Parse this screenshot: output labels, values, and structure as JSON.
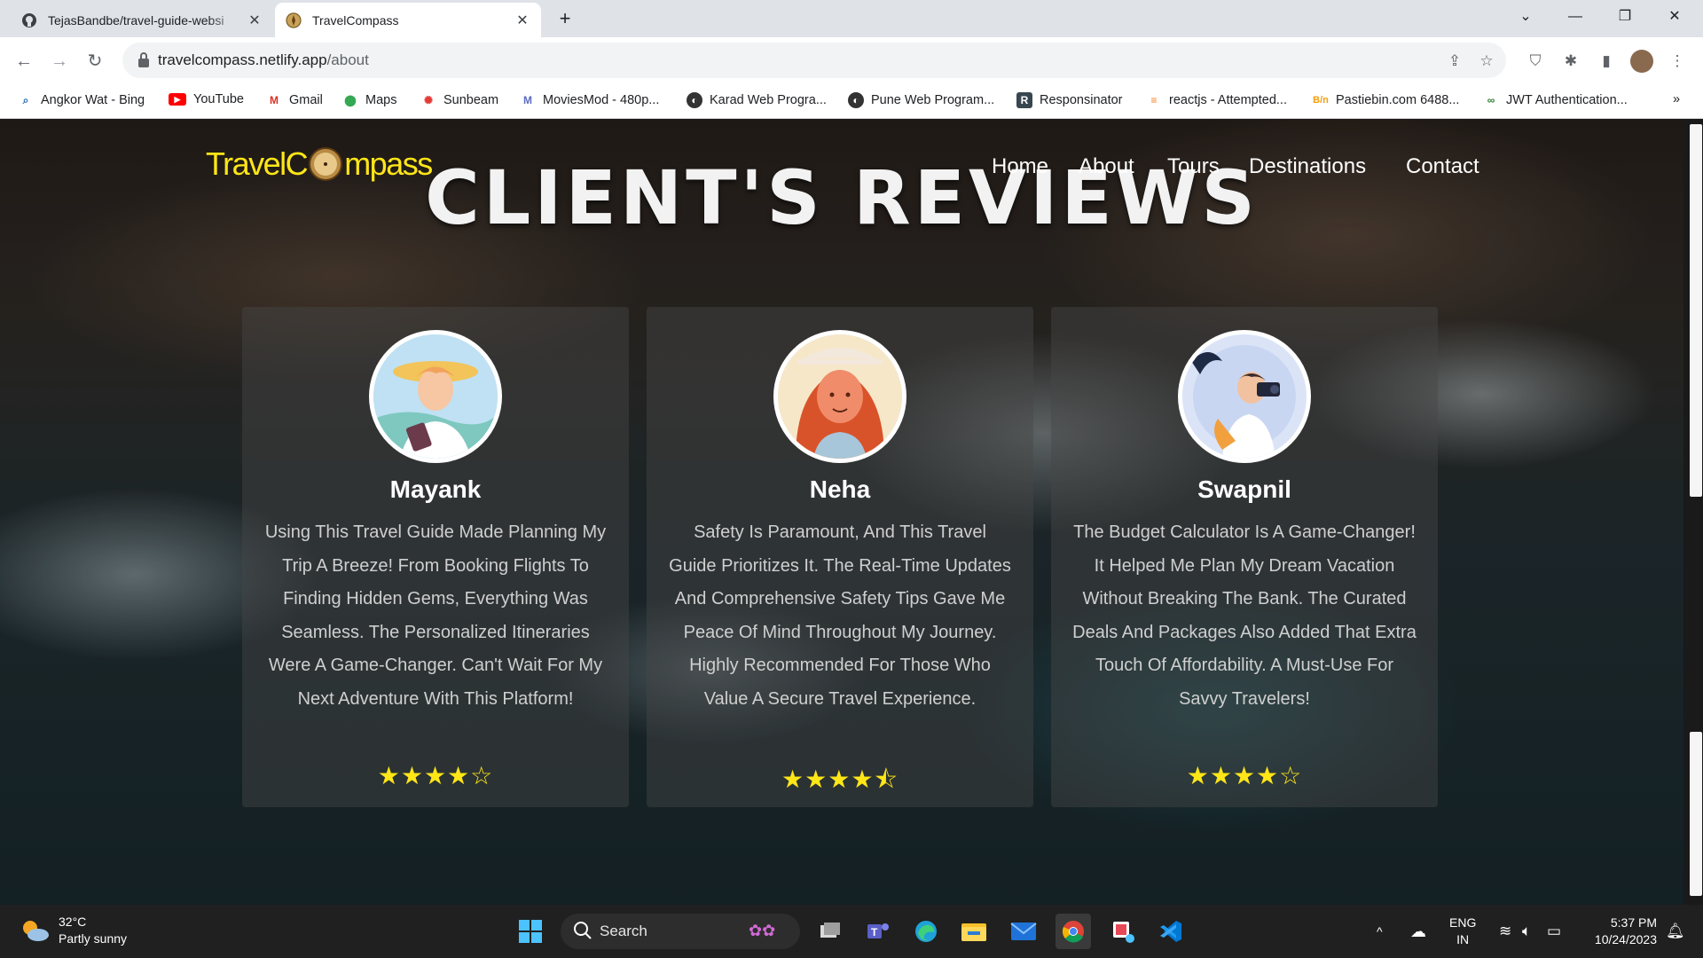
{
  "browser": {
    "tabs": [
      {
        "title": "TejasBandbe/travel-guide-websi",
        "active": false
      },
      {
        "title": "TravelCompass",
        "active": true
      }
    ],
    "tab_close": "✕",
    "new_tab": "+",
    "window_controls": {
      "dropdown": "⌄",
      "minimize": "—",
      "restore": "❐",
      "close": "✕"
    },
    "address": {
      "domain": "travelcompass.netlify.app",
      "path": "/about"
    },
    "bookmarks": [
      {
        "label": "Angkor Wat - Bing",
        "icon": "bing-search-icon"
      },
      {
        "label": "YouTube",
        "icon": "youtube-icon"
      },
      {
        "label": "Gmail",
        "icon": "gmail-icon"
      },
      {
        "label": "Maps",
        "icon": "maps-icon"
      },
      {
        "label": "Sunbeam",
        "icon": "sunbeam-icon"
      },
      {
        "label": "MoviesMod - 480p...",
        "icon": "moviesmod-icon"
      },
      {
        "label": "Karad Web Progra...",
        "icon": "globe-icon"
      },
      {
        "label": "Pune Web Program...",
        "icon": "globe-icon"
      },
      {
        "label": "Responsinator",
        "icon": "responsinator-icon"
      },
      {
        "label": "reactjs - Attempted...",
        "icon": "stackoverflow-icon"
      },
      {
        "label": "Pastiebin.com 6488...",
        "icon": "pastebin-icon"
      },
      {
        "label": "JWT Authentication...",
        "icon": "jwt-icon"
      }
    ],
    "bookmarks_more": "»"
  },
  "site": {
    "logo": {
      "before": "TravelC",
      "after": "mpass"
    },
    "nav": [
      "Home",
      "About",
      "Tours",
      "Destinations",
      "Contact"
    ],
    "heading": "CLIENT'S REVIEWS",
    "reviews": [
      {
        "name": "Mayank",
        "text": "Using This Travel Guide Made Planning My Trip A Breeze! From Booking Flights To Finding Hidden Gems, Everything Was Seamless. The Personalized Itineraries Were A Game-Changer. Can't Wait For My Next Adventure With This Platform!",
        "rating": 4,
        "stars": "★★★★☆"
      },
      {
        "name": "Neha",
        "text": "Safety Is Paramount, And This Travel Guide Prioritizes It. The Real-Time Updates And Comprehensive Safety Tips Gave Me Peace Of Mind Throughout My Journey. Highly Recommended For Those Who Value A Secure Travel Experience.",
        "rating": 4.5,
        "stars": "★★★★⯪"
      },
      {
        "name": "Swapnil",
        "text": "The Budget Calculator Is A Game-Changer! It Helped Me Plan My Dream Vacation Without Breaking The Bank. The Curated Deals And Packages Also Added That Extra Touch Of Affordability. A Must-Use For Savvy Travelers!",
        "rating": 4,
        "stars": "★★★★☆"
      }
    ],
    "accent_color": "#ffe617"
  },
  "taskbar": {
    "weather": {
      "temp": "32°C",
      "condition": "Partly sunny"
    },
    "search_label": "Search",
    "apps": [
      "windows-start-icon",
      "task-view-icon",
      "teams-icon",
      "edge-icon",
      "file-explorer-icon",
      "mail-icon",
      "chrome-icon",
      "snipping-tool-icon",
      "vscode-icon"
    ],
    "tray": {
      "chevron": "^",
      "lang_top": "ENG",
      "lang_bottom": "IN"
    },
    "clock": {
      "time": "5:37 PM",
      "date": "10/24/2023"
    }
  }
}
